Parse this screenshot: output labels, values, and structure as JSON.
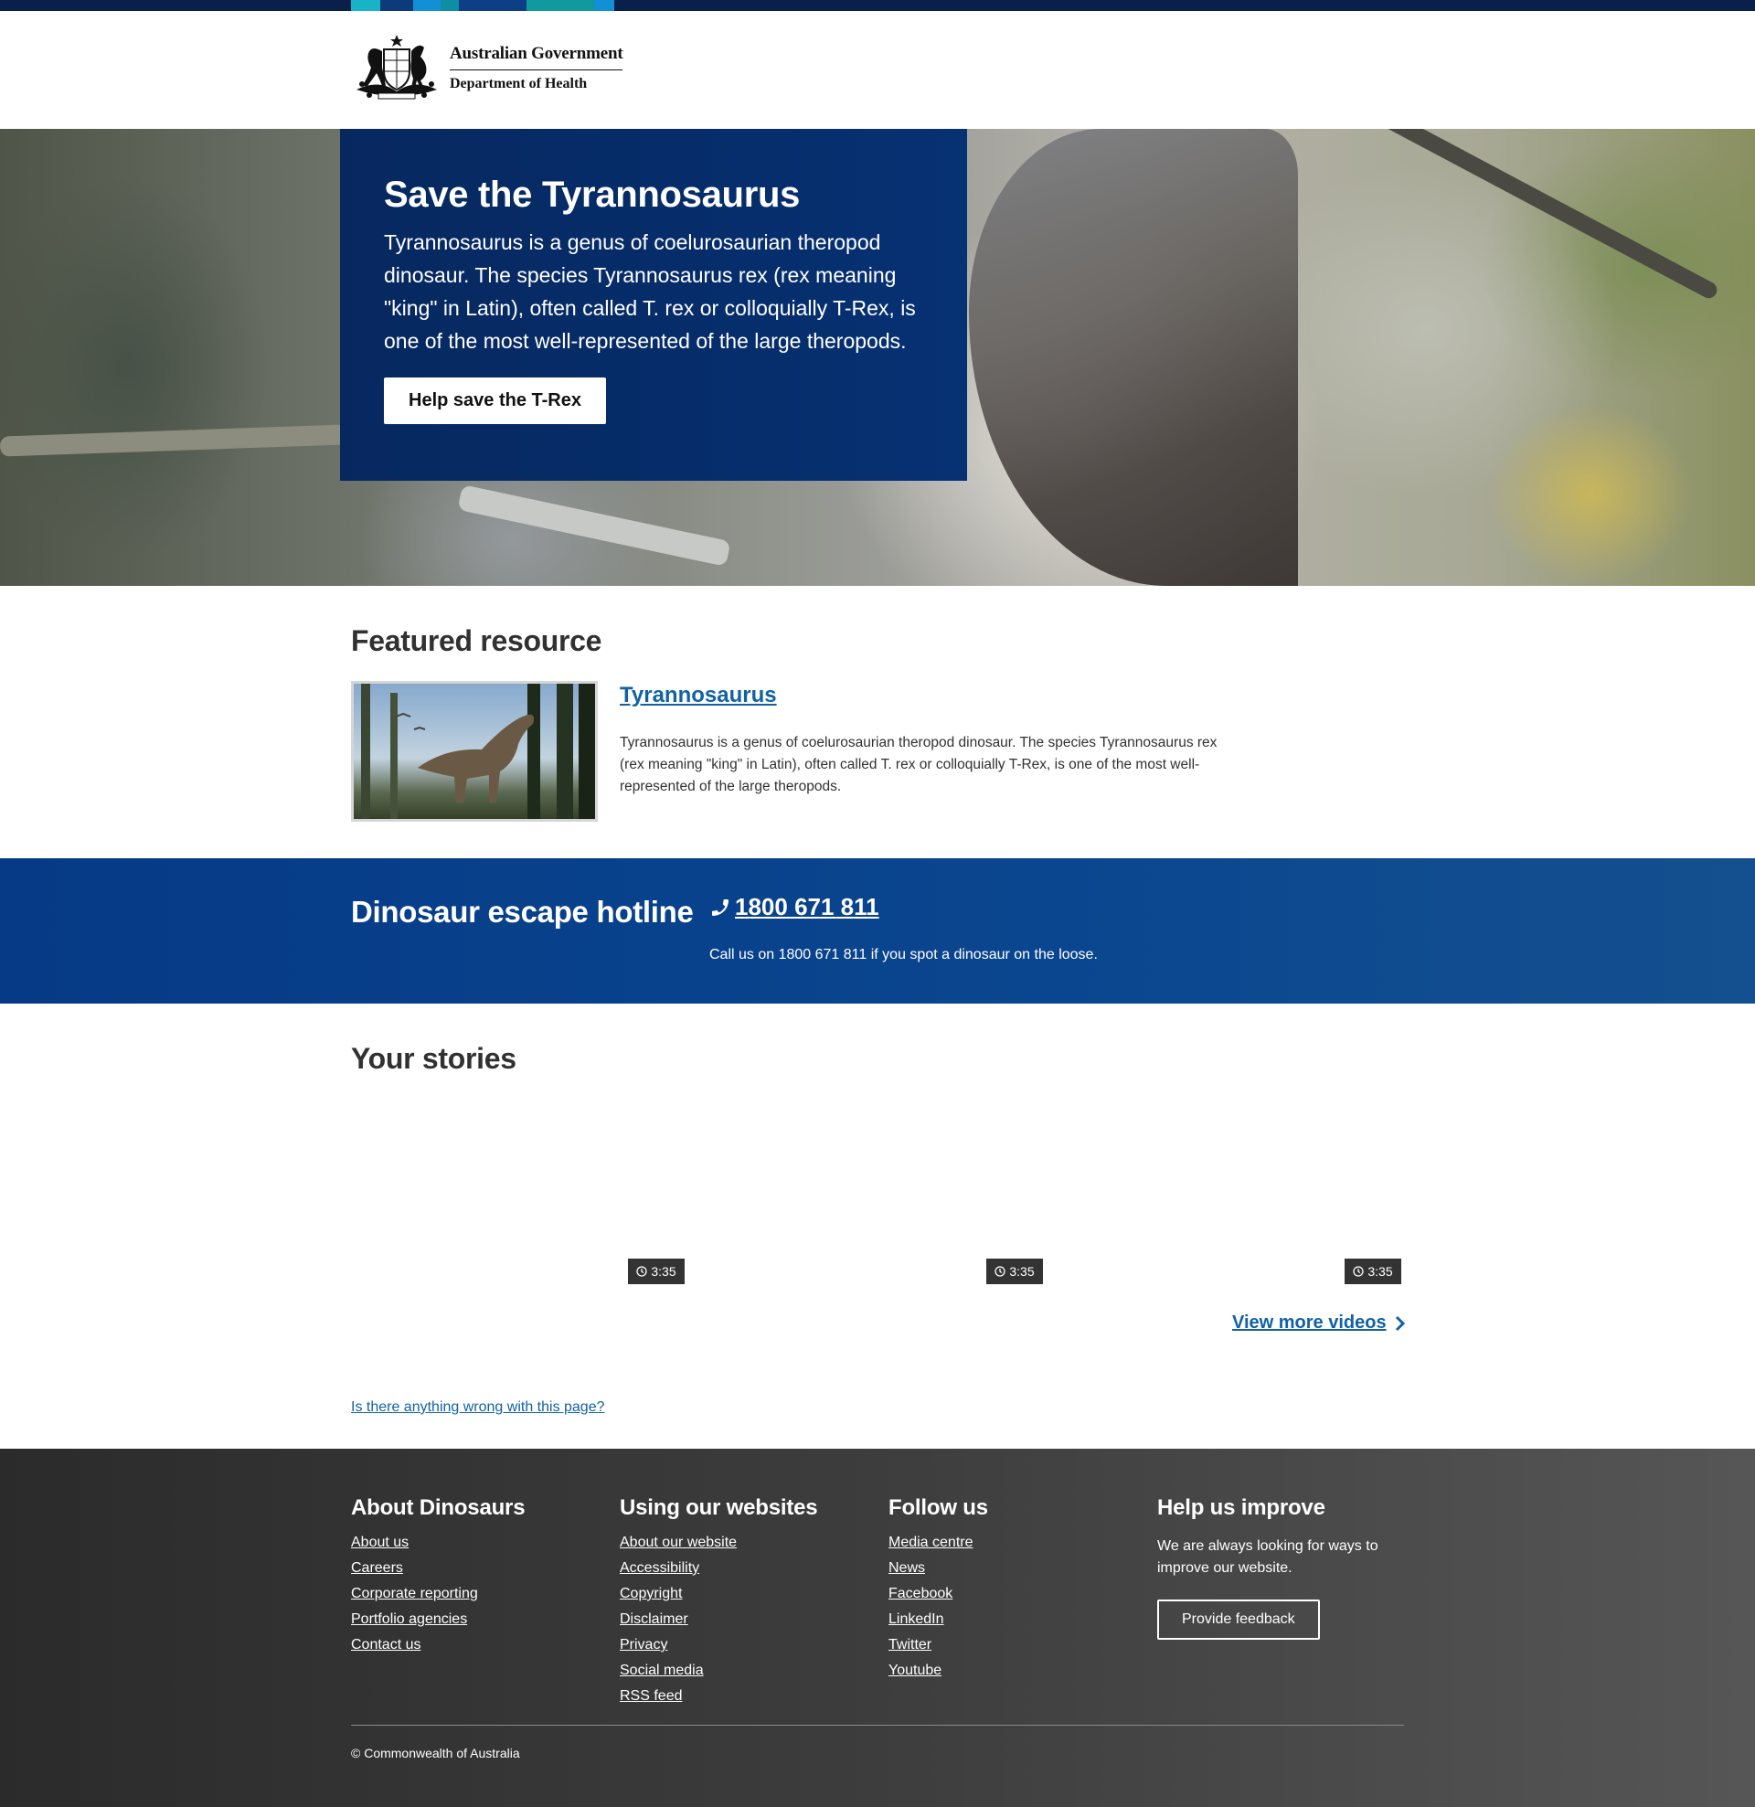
{
  "header": {
    "org_line1": "Australian Government",
    "org_line2": "Department of Health"
  },
  "colors": {
    "brand_navy": "#063173",
    "hotline_blue": "#0a468f",
    "link_blue": "#1262a3",
    "footer_bg": "#3d3d3d"
  },
  "hero": {
    "title": "Save the Tyrannosaurus",
    "text": "Tyrannosaurus is a genus of coelurosaurian theropod dinosaur. The species Tyrannosaurus rex (rex meaning \"king\" in Latin), often called T. rex or colloquially T-Rex, is one of the most well-represented of the large theropods.",
    "button_label": "Help save the T-Rex"
  },
  "featured": {
    "heading": "Featured resource",
    "link": "Tyrannosaurus",
    "description": "Tyrannosaurus is a genus of coelurosaurian theropod dinosaur. The species Tyrannosaurus rex (rex meaning \"king\" in Latin), often called T. rex or colloquially T-Rex, is one of the most well-represented of the large theropods."
  },
  "hotline": {
    "title": "Dinosaur escape hotline",
    "icon": "phone-icon",
    "phone": "1800 671 811",
    "note": "Call us on 1800 671 811 if you spot a dinosaur on the loose."
  },
  "stories": {
    "heading": "Your stories",
    "videos": [
      {
        "duration": "3:35"
      },
      {
        "duration": "3:35"
      },
      {
        "duration": "3:35"
      }
    ],
    "view_more": "View more videos"
  },
  "report_link": "Is there anything wrong with this page?",
  "footer": {
    "col1": {
      "heading": "About Dinosaurs",
      "links": [
        "About us",
        "Careers",
        "Corporate reporting",
        "Portfolio agencies",
        "Contact us"
      ]
    },
    "col2": {
      "heading": "Using our websites",
      "links": [
        "About our website",
        "Accessibility",
        "Copyright",
        "Disclaimer",
        "Privacy",
        "Social media",
        "RSS feed"
      ]
    },
    "col3": {
      "heading": "Follow us",
      "links": [
        "Media centre",
        "News",
        "Facebook",
        "LinkedIn",
        "Twitter",
        "Youtube"
      ]
    },
    "col4": {
      "heading": "Help us improve",
      "text": "We are always looking for ways to improve our website.",
      "button_label": "Provide feedback"
    },
    "copyright": "© Commonwealth of Australia"
  }
}
